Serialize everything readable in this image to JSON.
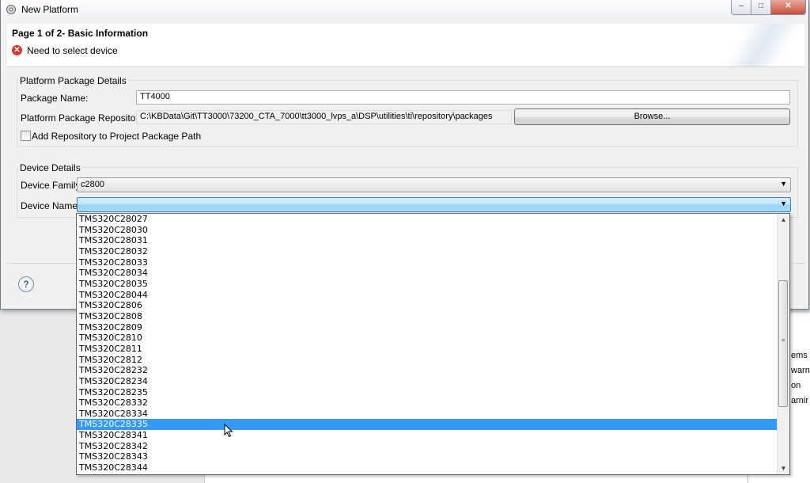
{
  "window": {
    "title": "New Platform",
    "controls": {
      "minimize": "–",
      "maximize": "□",
      "close": "✕"
    }
  },
  "header": {
    "page_title": "Page 1 of 2- Basic Information",
    "error_message": "Need to select device"
  },
  "platform_package": {
    "group_label": "Platform Package Details",
    "package_name_label": "Package Name:",
    "package_name_value": "TT4000",
    "repository_label": "Platform Package Repository:",
    "repository_value": "C:\\KBData\\Git\\TT3000\\73200_CTA_7000\\tt3000_lvps_a\\DSP\\utilities\\ti\\repository\\packages",
    "browse_label": "Browse...",
    "add_repo_label": "Add Repository to Project Package Path",
    "add_repo_checked": false
  },
  "device": {
    "group_label": "Device Details",
    "family_label": "Device Family",
    "family_value": "c2800",
    "name_label": "Device Name",
    "name_value": ""
  },
  "device_name_options": [
    "TMS320C28027",
    "TMS320C28030",
    "TMS320C28031",
    "TMS320C28032",
    "TMS320C28033",
    "TMS320C28034",
    "TMS320C28035",
    "TMS320C28044",
    "TMS320C2806",
    "TMS320C2808",
    "TMS320C2809",
    "TMS320C2810",
    "TMS320C2811",
    "TMS320C2812",
    "TMS320C28232",
    "TMS320C28234",
    "TMS320C28235",
    "TMS320C28332",
    "TMS320C28334",
    "TMS320C28335",
    "TMS320C28341",
    "TMS320C28342",
    "TMS320C28343",
    "TMS320C28344"
  ],
  "highlighted_option": "TMS320C28335",
  "background_text": [
    "ems",
    "warn",
    "on",
    "arnir"
  ],
  "icons": {
    "error": "error-x-icon",
    "help": "help-question-icon",
    "combo_arrow": "chevron-down-icon"
  },
  "colors": {
    "selection": "#3399ff",
    "error": "#d9352c",
    "combo_active": "#a8d8f7"
  }
}
